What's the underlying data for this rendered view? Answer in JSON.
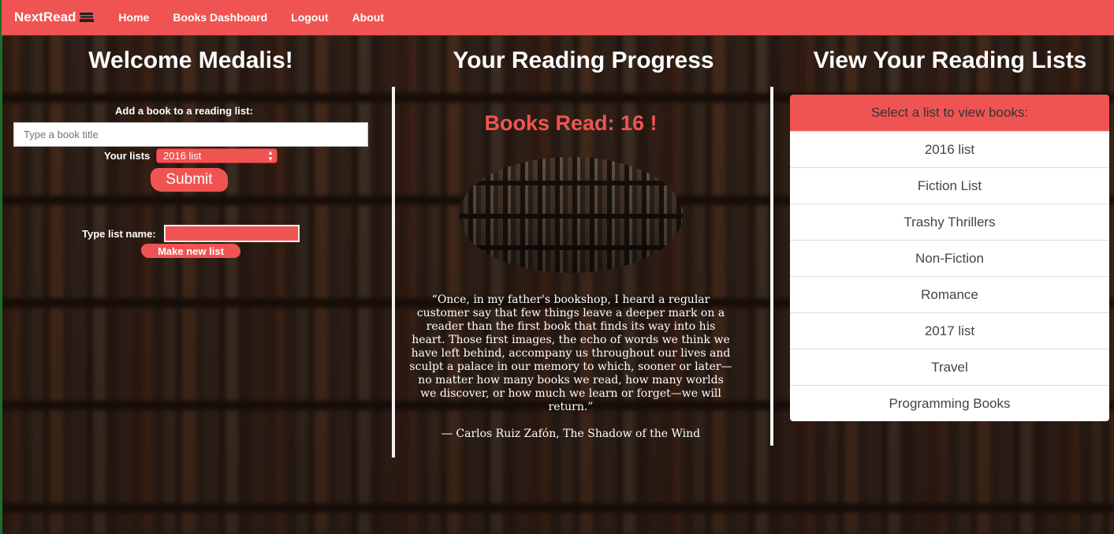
{
  "nav": {
    "brand": "NextRead",
    "links": [
      "Home",
      "Books Dashboard",
      "Logout",
      "About"
    ]
  },
  "left": {
    "heading": "Welcome Medalis!",
    "add_label": "Add a book to a reading list:",
    "book_placeholder": "Type a book title",
    "lists_label": "Your lists",
    "selected_list": "2016 list",
    "submit_label": "Submit",
    "listname_label": "Type list name:",
    "newlist_label": "Make new list"
  },
  "middle": {
    "heading": "Your Reading Progress",
    "books_read": "Books Read: 16 !",
    "quote": "“Once, in my father's bookshop, I heard a regular customer say that few things leave a deeper mark on a reader than the first book that finds its way into his heart. Those first images, the echo of words we think we have left behind, accompany us throughout our lives and sculpt a palace in our memory to which, sooner or later—no matter how many books we read, how many worlds we discover, or how much we learn or forget—we will return.”",
    "author": "― Carlos Ruiz Zafón, The Shadow of the Wind"
  },
  "right": {
    "heading": "View Your Reading Lists",
    "header": "Select a list to view books:",
    "lists": [
      "2016 list",
      "Fiction List",
      "Trashy Thrillers",
      "Non-Fiction",
      "Romance",
      "2017 list",
      "Travel",
      "Programming Books"
    ]
  },
  "colors": {
    "accent": "#f05452",
    "text_light": "#ffffff"
  }
}
